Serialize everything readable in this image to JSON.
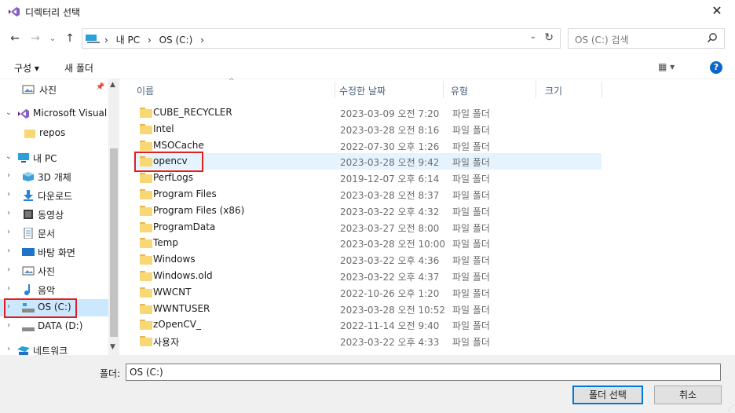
{
  "window": {
    "title": "디렉터리 선택",
    "close_glyph": "✕"
  },
  "nav": {
    "back": "←",
    "forward": "→",
    "recent": "⌄",
    "up": "↑",
    "breadcrumbs": [
      "›",
      "내 PC",
      "›",
      "OS (C:)",
      "›"
    ],
    "dropdown": "⌄",
    "refresh": "↻",
    "search_placeholder": "OS (C:) 검색"
  },
  "toolbar": {
    "organize": "구성 ▾",
    "new_folder": "새 폴더",
    "view": "▦ ▾",
    "help": "?"
  },
  "tree": [
    {
      "label": "사진",
      "chev": "",
      "icon": "pictures-icon",
      "pin": "📌"
    },
    {
      "label": "Microsoft Visual S",
      "chev": "⌄",
      "icon": "visual-studio-icon"
    },
    {
      "label": "repos",
      "chev": "",
      "icon": "folder-icon"
    },
    {
      "label": "내 PC",
      "chev": "⌄",
      "icon": "pc-icon"
    },
    {
      "label": "3D 개체",
      "chev": "›",
      "icon": "3d-objects-icon"
    },
    {
      "label": "다운로드",
      "chev": "›",
      "icon": "downloads-icon"
    },
    {
      "label": "동영상",
      "chev": "›",
      "icon": "videos-icon"
    },
    {
      "label": "문서",
      "chev": "›",
      "icon": "documents-icon"
    },
    {
      "label": "바탕 화면",
      "chev": "›",
      "icon": "desktop-icon"
    },
    {
      "label": "사진",
      "chev": "›",
      "icon": "pictures-icon"
    },
    {
      "label": "음악",
      "chev": "›",
      "icon": "music-icon"
    },
    {
      "label": "OS (C:)",
      "chev": "›",
      "icon": "drive-os-icon",
      "selected": true
    },
    {
      "label": "DATA (D:)",
      "chev": "›",
      "icon": "drive-icon"
    },
    {
      "label": "네트워크",
      "chev": "›",
      "icon": "network-icon"
    }
  ],
  "columns": {
    "name": "이름",
    "modified": "수정한 날짜",
    "type": "유형",
    "size": "크기"
  },
  "files": [
    {
      "name": "CUBE_RECYCLER",
      "date": "2023-03-09 오전 7:20",
      "type": "파일 폴더"
    },
    {
      "name": "Intel",
      "date": "2023-03-28 오전 8:16",
      "type": "파일 폴더"
    },
    {
      "name": "MSOCache",
      "date": "2022-07-30 오후 1:26",
      "type": "파일 폴더"
    },
    {
      "name": "opencv",
      "date": "2023-03-28 오전 9:42",
      "type": "파일 폴더",
      "hover": true
    },
    {
      "name": "PerfLogs",
      "date": "2019-12-07 오후 6:14",
      "type": "파일 폴더"
    },
    {
      "name": "Program Files",
      "date": "2023-03-28 오전 8:37",
      "type": "파일 폴더"
    },
    {
      "name": "Program Files (x86)",
      "date": "2023-03-22 오후 4:32",
      "type": "파일 폴더"
    },
    {
      "name": "ProgramData",
      "date": "2023-03-27 오전 8:00",
      "type": "파일 폴더"
    },
    {
      "name": "Temp",
      "date": "2023-03-28 오전 10:00",
      "type": "파일 폴더"
    },
    {
      "name": "Windows",
      "date": "2023-03-22 오후 4:36",
      "type": "파일 폴더"
    },
    {
      "name": "Windows.old",
      "date": "2023-03-22 오후 4:37",
      "type": "파일 폴더"
    },
    {
      "name": "WWCNT",
      "date": "2022-10-26 오후 1:20",
      "type": "파일 폴더"
    },
    {
      "name": "WWNTUSER",
      "date": "2023-03-28 오전 10:52",
      "type": "파일 폴더"
    },
    {
      "name": "zOpenCV_",
      "date": "2022-11-14 오전 9:40",
      "type": "파일 폴더"
    },
    {
      "name": "사용자",
      "date": "2023-03-22 오후 4:33",
      "type": "파일 폴더"
    }
  ],
  "footer": {
    "folder_label": "폴더:",
    "folder_value": "OS (C:)",
    "select_button": "폴더 선택",
    "cancel_button": "취소"
  },
  "colors": {
    "accent": "#0078d7",
    "selection": "#cce8ff",
    "hover": "#e5f3ff",
    "highlight_box": "#e02020",
    "folder": "#f8d775"
  }
}
